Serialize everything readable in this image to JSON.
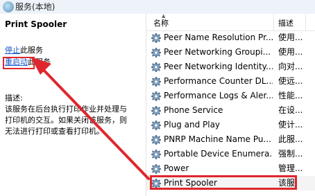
{
  "window": {
    "title": "服务(本地)"
  },
  "left_panel": {
    "service_name": "Print Spooler",
    "stop": {
      "link": "停止",
      "suffix": "此服务"
    },
    "restart": {
      "link": "重启动",
      "suffix": "此服务"
    },
    "description_label": "描述:",
    "description_lines": [
      "该服务在后台执行打印作业并处理与",
      "打印机的交互。如果关闭该服务，则",
      "无法进行打印或查看打印机。"
    ]
  },
  "table": {
    "headers": {
      "name": "名称",
      "description": "描述"
    },
    "rows": [
      {
        "name": "Peer Name Resolution Pr...",
        "desc": "使用..."
      },
      {
        "name": "Peer Networking Groupi...",
        "desc": "使用..."
      },
      {
        "name": "Peer Networking Identity...",
        "desc": "向对..."
      },
      {
        "name": "Performance Counter DL...",
        "desc": "使远..."
      },
      {
        "name": "Performance Logs & Aler...",
        "desc": "性能..."
      },
      {
        "name": "Phone Service",
        "desc": "在设..."
      },
      {
        "name": "Plug and Play",
        "desc": "使计..."
      },
      {
        "name": "PNRP Machine Name Pu...",
        "desc": "此服..."
      },
      {
        "name": "Portable Device Enumera...",
        "desc": "强制..."
      },
      {
        "name": "Power",
        "desc": "管理..."
      },
      {
        "name": "Print Spooler",
        "desc": "该服"
      }
    ]
  },
  "colors": {
    "link": "#1a59c6",
    "highlight": "#e0262d"
  },
  "icons": {
    "title": "services-icon",
    "row": "gear-icon"
  }
}
